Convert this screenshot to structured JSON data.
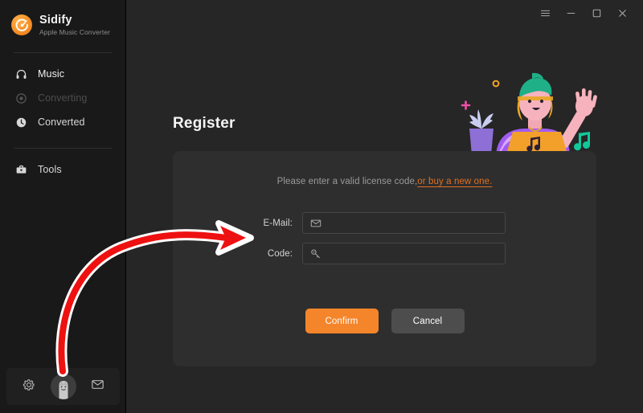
{
  "app": {
    "brand_name": "Sidify",
    "brand_subtitle": "Apple Music Converter",
    "accent_color": "#f5852a",
    "link_color": "#e2701f",
    "window_bg": "#262626",
    "sidebar_bg": "#191919",
    "card_bg": "#2e2e2e"
  },
  "titlebar": {
    "buttons": [
      {
        "name": "menu-button",
        "icon": "hamburger-menu-icon",
        "label": "Menu"
      },
      {
        "name": "minimize-button",
        "icon": "minimize-icon",
        "label": "Minimize"
      },
      {
        "name": "maximize-button",
        "icon": "maximize-icon",
        "label": "Maximize"
      },
      {
        "name": "close-button",
        "icon": "close-icon",
        "label": "Close"
      }
    ]
  },
  "sidebar": {
    "items": [
      {
        "label": "Music",
        "icon": "headphones-icon",
        "state": "active"
      },
      {
        "label": "Converting",
        "icon": "converting-icon",
        "state": "disabled"
      },
      {
        "label": "Converted",
        "icon": "clock-icon",
        "state": "normal"
      },
      {
        "label": "Tools",
        "icon": "toolbox-icon",
        "state": "normal"
      }
    ],
    "bottom_bar": {
      "settings_icon": "gear-icon",
      "account_avatar": "user-avatar",
      "feedback_icon": "envelope-icon"
    }
  },
  "main": {
    "page_title": "Register",
    "illustration": "person-waving-at-laptop-illustration",
    "register": {
      "hint_text": "Please enter a valid license code,",
      "buy_link_text": "or buy a new one.",
      "fields": [
        {
          "label": "E-Mail:",
          "icon": "envelope-icon",
          "value": "",
          "placeholder": ""
        },
        {
          "label": "Code:",
          "icon": "key-icon",
          "value": "",
          "placeholder": ""
        }
      ],
      "confirm_label": "Confirm",
      "cancel_label": "Cancel"
    }
  },
  "annotation": {
    "arrow": "red-curved-arrow-from-avatar-to-email-field",
    "color": "#ee1111"
  }
}
